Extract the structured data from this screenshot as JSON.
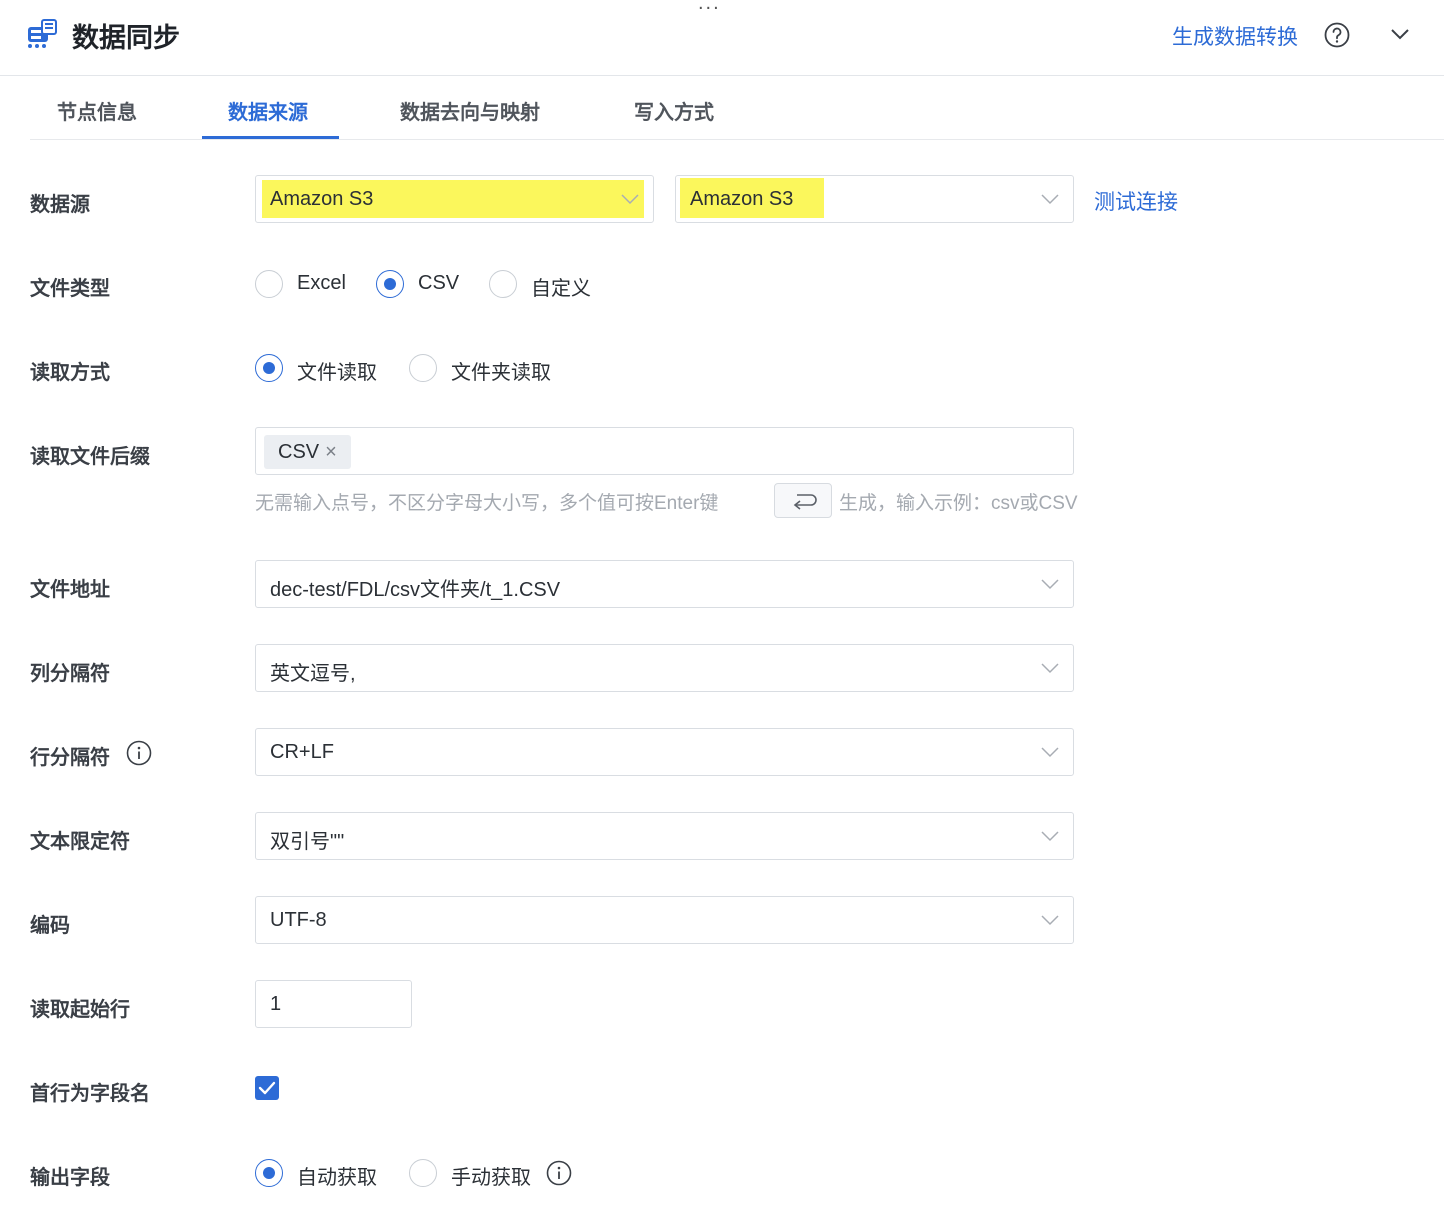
{
  "header": {
    "title": "数据同步",
    "generate_link": "生成数据转换",
    "top_dots": "..."
  },
  "tabs": [
    {
      "label": "节点信息"
    },
    {
      "label": "数据来源",
      "active": true
    },
    {
      "label": "数据去向与映射"
    },
    {
      "label": "写入方式"
    }
  ],
  "form": {
    "datasource": {
      "label": "数据源",
      "type_value": "Amazon S3",
      "connection_value": "Amazon S3",
      "test_link": "测试连接"
    },
    "file_type": {
      "label": "文件类型",
      "options": [
        "Excel",
        "CSV",
        "自定义"
      ],
      "selected": "CSV"
    },
    "read_mode": {
      "label": "读取方式",
      "options": [
        "文件读取",
        "文件夹读取"
      ],
      "selected": "文件读取"
    },
    "suffix": {
      "label": "读取文件后缀",
      "tags": [
        "CSV"
      ],
      "hint_before": "无需输入点号，不区分字母大小写，多个值可按Enter键",
      "hint_after": "生成，输入示例：csv或CSV"
    },
    "file_path": {
      "label": "文件地址",
      "value": "dec-test/FDL/csv文件夹/t_1.CSV"
    },
    "col_sep": {
      "label": "列分隔符",
      "value": "英文逗号,"
    },
    "row_sep": {
      "label": "行分隔符",
      "value": "CR+LF"
    },
    "text_qualifier": {
      "label": "文本限定符",
      "value": "双引号\"\""
    },
    "encoding": {
      "label": "编码",
      "value": "UTF-8"
    },
    "start_row": {
      "label": "读取起始行",
      "value": "1"
    },
    "header_row": {
      "label": "首行为字段名",
      "checked": true
    },
    "output_fields": {
      "label": "输出字段",
      "options": [
        "自动获取",
        "手动获取"
      ],
      "selected": "自动获取"
    }
  },
  "colors": {
    "accent": "#2d6bd6",
    "highlight": "#fbf75c"
  }
}
